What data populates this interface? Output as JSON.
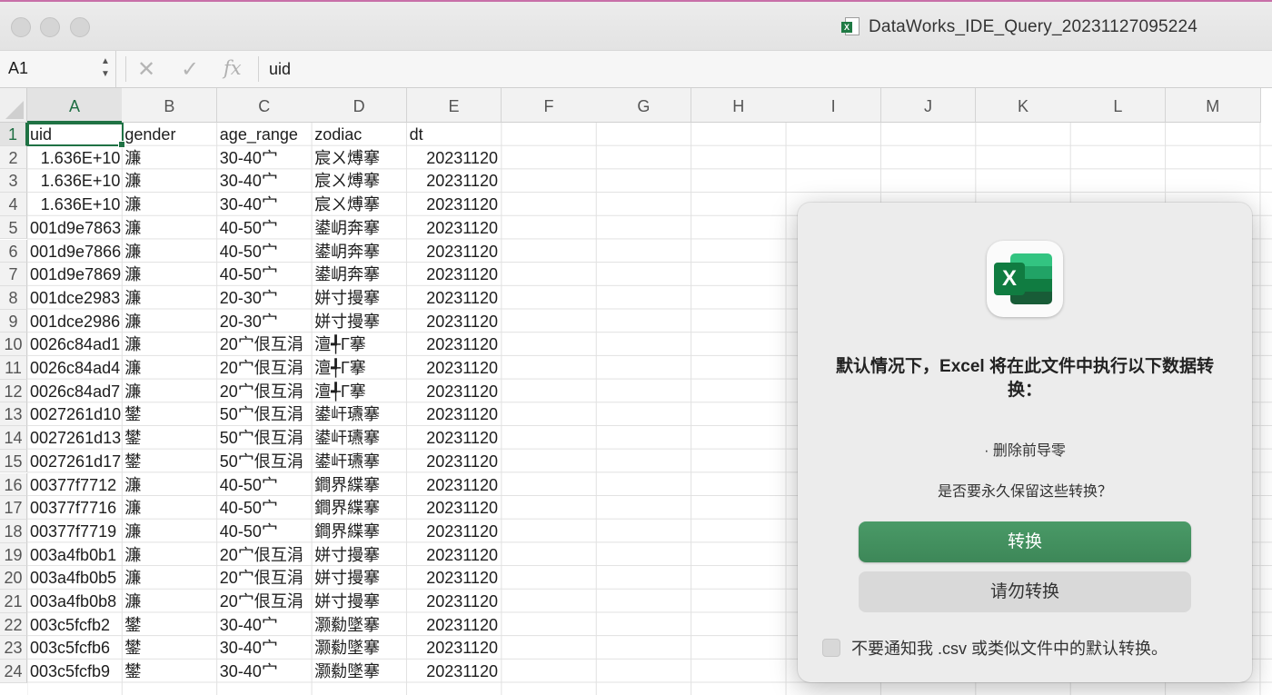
{
  "window": {
    "title": "DataWorks_IDE_Query_20231127095224",
    "file_icon": "excel-csv-file-icon"
  },
  "formula_bar": {
    "name_box": "A1",
    "cancel_icon": "✕",
    "confirm_icon": "✓",
    "fx_label": "fx",
    "value": "uid"
  },
  "grid": {
    "columns": [
      "A",
      "B",
      "C",
      "D",
      "E",
      "F",
      "G",
      "H",
      "I",
      "J",
      "K",
      "L",
      "M"
    ],
    "rows": [
      "1",
      "2",
      "3",
      "4",
      "5",
      "6",
      "7",
      "8",
      "9",
      "10",
      "11",
      "12",
      "13",
      "14",
      "15",
      "16",
      "17",
      "18",
      "19",
      "20",
      "21",
      "22",
      "23",
      "24"
    ],
    "cells": [
      [
        "uid",
        "gender",
        "age_range",
        "zodiac",
        "dt"
      ],
      [
        "1.636E+10",
        "濂",
        "30-40宀",
        "宸ㄨ煿搴",
        "20231120"
      ],
      [
        "1.636E+10",
        "濂",
        "30-40宀",
        "宸ㄨ煿搴",
        "20231120"
      ],
      [
        "1.636E+10",
        "濂",
        "30-40宀",
        "宸ㄨ煿搴",
        "20231120"
      ],
      [
        "001d9e7863",
        "濂",
        "40-50宀",
        "鍙岄奔搴",
        "20231120"
      ],
      [
        "001d9e7866",
        "濂",
        "40-50宀",
        "鍙岄奔搴",
        "20231120"
      ],
      [
        "001d9e7869",
        "濂",
        "40-50宀",
        "鍙岄奔搴",
        "20231120"
      ],
      [
        "001dce2983",
        "濂",
        "20-30宀",
        "姘寸摱搴",
        "20231120"
      ],
      [
        "001dce2986",
        "濂",
        "20-30宀",
        "姘寸摱搴",
        "20231120"
      ],
      [
        "0026c84ad1",
        "濂",
        "20宀佷互涓",
        "澶╃Г搴",
        "20231120"
      ],
      [
        "0026c84ad4",
        "濂",
        "20宀佷互涓",
        "澶╃Г搴",
        "20231120"
      ],
      [
        "0026c84ad7",
        "濂",
        "20宀佷互涓",
        "澶╃Г搴",
        "20231120"
      ],
      [
        "0027261d10",
        "鐢",
        "50宀佷互涓",
        "鍙屽瓙搴",
        "20231120"
      ],
      [
        "0027261d13",
        "鐢",
        "50宀佷互涓",
        "鍙屽瓙搴",
        "20231120"
      ],
      [
        "0027261d17",
        "鐢",
        "50宀佷互涓",
        "鍙屽瓙搴",
        "20231120"
      ],
      [
        "00377f7712",
        "濂",
        "40-50宀",
        "鐧界緤搴",
        "20231120"
      ],
      [
        "00377f7716",
        "濂",
        "40-50宀",
        "鐧界緤搴",
        "20231120"
      ],
      [
        "00377f7719",
        "濂",
        "40-50宀",
        "鐧界緤搴",
        "20231120"
      ],
      [
        "003a4fb0b1",
        "濂",
        "20宀佷互涓",
        "姘寸摱搴",
        "20231120"
      ],
      [
        "003a4fb0b5",
        "濂",
        "20宀佷互涓",
        "姘寸摱搴",
        "20231120"
      ],
      [
        "003a4fb0b8",
        "濂",
        "20宀佷互涓",
        "姘寸摱搴",
        "20231120"
      ],
      [
        "003c5fcfb2",
        "鐢",
        "30-40宀",
        "灏勬墜搴",
        "20231120"
      ],
      [
        "003c5fcfb6",
        "鐢",
        "30-40宀",
        "灏勬墜搴",
        "20231120"
      ],
      [
        "003c5fcfb9",
        "鐢",
        "30-40宀",
        "灏勬墜搴",
        "20231120"
      ]
    ]
  },
  "dialog": {
    "icon": "excel-app-icon",
    "icon_letter": "X",
    "title": "默认情况下，Excel 将在此文件中执行以下数据转换：",
    "item": "· 删除前导零",
    "question": "是否要永久保留这些转换？",
    "convert_button": "转换",
    "no_convert_button": "请勿转换",
    "checkbox_label": "不要通知我 .csv 或类似文件中的默认转换。",
    "checkbox_checked": false
  }
}
